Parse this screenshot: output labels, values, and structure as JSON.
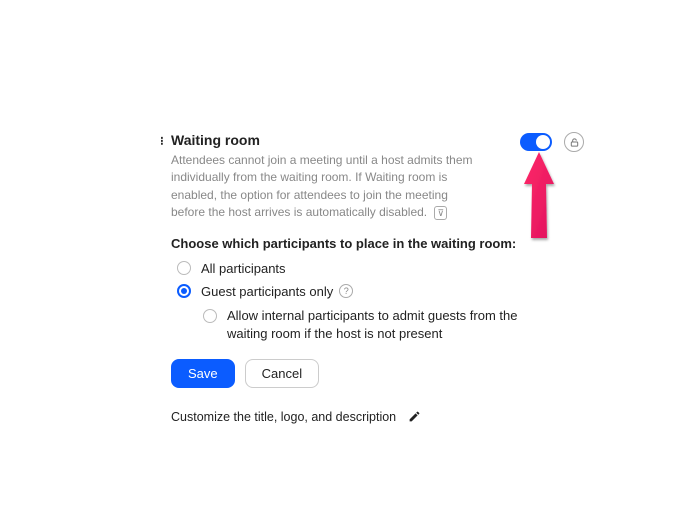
{
  "title": "Waiting room",
  "description": "Attendees cannot join a meeting until a host admits them individually from the waiting room. If Waiting room is enabled, the option for attendees to join the meeting before the host arrives is automatically disabled.",
  "reset_badge": "⊽",
  "subhead": "Choose which participants to place in the waiting room:",
  "options": {
    "all": "All participants",
    "guest": "Guest participants only",
    "sub": "Allow internal participants to admit guests from the waiting room if the host is not present"
  },
  "buttons": {
    "save": "Save",
    "cancel": "Cancel"
  },
  "customize": "Customize the title, logo, and description",
  "help_glyph": "?",
  "toggle_on": true
}
